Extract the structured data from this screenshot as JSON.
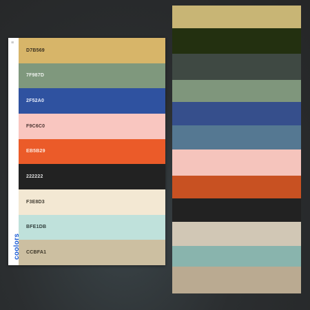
{
  "card": {
    "brand": "coolors",
    "menu_icon": "menu-icon",
    "swatches": [
      {
        "hex": "D7B569",
        "color": "#D7B569",
        "text": "#3a3020"
      },
      {
        "hex": "7F987D",
        "color": "#7F987D",
        "text": "#eef2ee"
      },
      {
        "hex": "2F52A0",
        "color": "#2F52A0",
        "text": "#e8eefc"
      },
      {
        "hex": "F9C6C0",
        "color": "#F9C6C0",
        "text": "#4a3431"
      },
      {
        "hex": "EB5B29",
        "color": "#EB5B29",
        "text": "#fde9df"
      },
      {
        "hex": "222222",
        "color": "#222222",
        "text": "#dddddd"
      },
      {
        "hex": "F3E8D3",
        "color": "#F3E8D3",
        "text": "#3f3a30"
      },
      {
        "hex": "BFE1DB",
        "color": "#BFE1DB",
        "text": "#2f3d3a"
      },
      {
        "hex": "CCBFA1",
        "color": "#CCBFA1",
        "text": "#3a3426"
      }
    ]
  },
  "preview_bands": [
    {
      "color": "#C8B575",
      "share": 33
    },
    {
      "color": "#233010",
      "share": 37
    },
    {
      "color": "#3F4943",
      "share": 38
    },
    {
      "color": "#7F967C",
      "share": 32
    },
    {
      "color": "#364F8C",
      "share": 34
    },
    {
      "color": "#557892",
      "share": 35
    },
    {
      "color": "#F5C4BC",
      "share": 38
    },
    {
      "color": "#C85122",
      "share": 33
    },
    {
      "color": "#222222",
      "share": 34
    },
    {
      "color": "#D1C7B5",
      "share": 35
    },
    {
      "color": "#89B4AD",
      "share": 30
    },
    {
      "color": "#BAAA91",
      "share": 39
    }
  ]
}
